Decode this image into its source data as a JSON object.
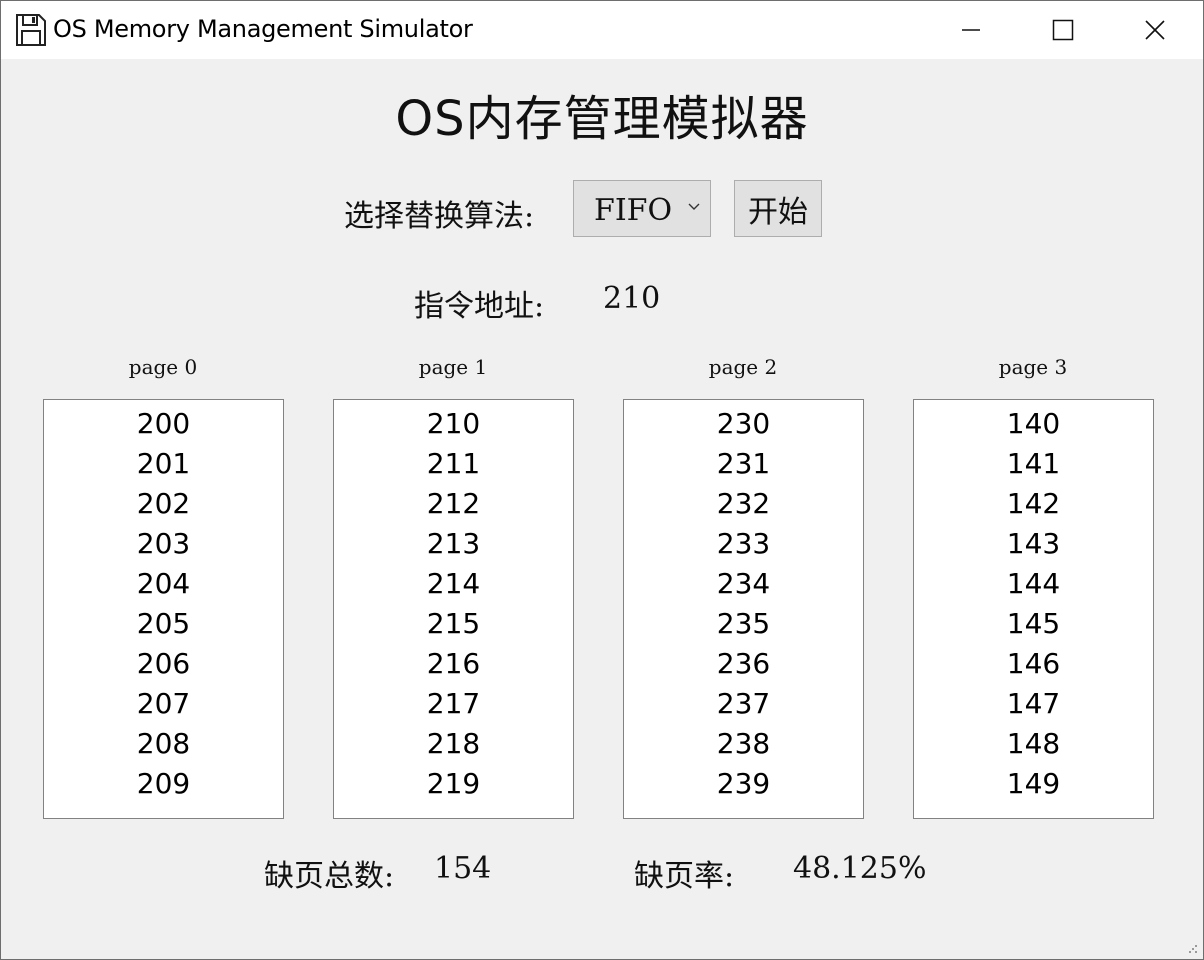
{
  "window": {
    "title": "OS Memory Management Simulator",
    "icon": "floppy-disk-icon",
    "controls": [
      "minimize-icon",
      "maximize-icon",
      "close-icon"
    ]
  },
  "main": {
    "heading": "OS内存管理模拟器",
    "algorithm": {
      "label": "选择替换算法:",
      "selected": "FIFO",
      "start_label": "开始"
    },
    "address": {
      "label": "指令地址:",
      "value": "210"
    },
    "pages": [
      {
        "title": "page 0",
        "items": [
          "200",
          "201",
          "202",
          "203",
          "204",
          "205",
          "206",
          "207",
          "208",
          "209"
        ]
      },
      {
        "title": "page 1",
        "items": [
          "210",
          "211",
          "212",
          "213",
          "214",
          "215",
          "216",
          "217",
          "218",
          "219"
        ]
      },
      {
        "title": "page 2",
        "items": [
          "230",
          "231",
          "232",
          "233",
          "234",
          "235",
          "236",
          "237",
          "238",
          "239"
        ]
      },
      {
        "title": "page 3",
        "items": [
          "140",
          "141",
          "142",
          "143",
          "144",
          "145",
          "146",
          "147",
          "148",
          "149"
        ]
      }
    ],
    "stats": {
      "fault_total_label": "缺页总数:",
      "fault_total_value": "154",
      "fault_rate_label": "缺页率:",
      "fault_rate_value": "48.125%"
    }
  },
  "colors": {
    "window_bg": "#f0f0f0",
    "titlebar_bg": "#ffffff",
    "button_bg": "#e1e1e1",
    "list_bg": "#ffffff",
    "text": "#111111"
  }
}
